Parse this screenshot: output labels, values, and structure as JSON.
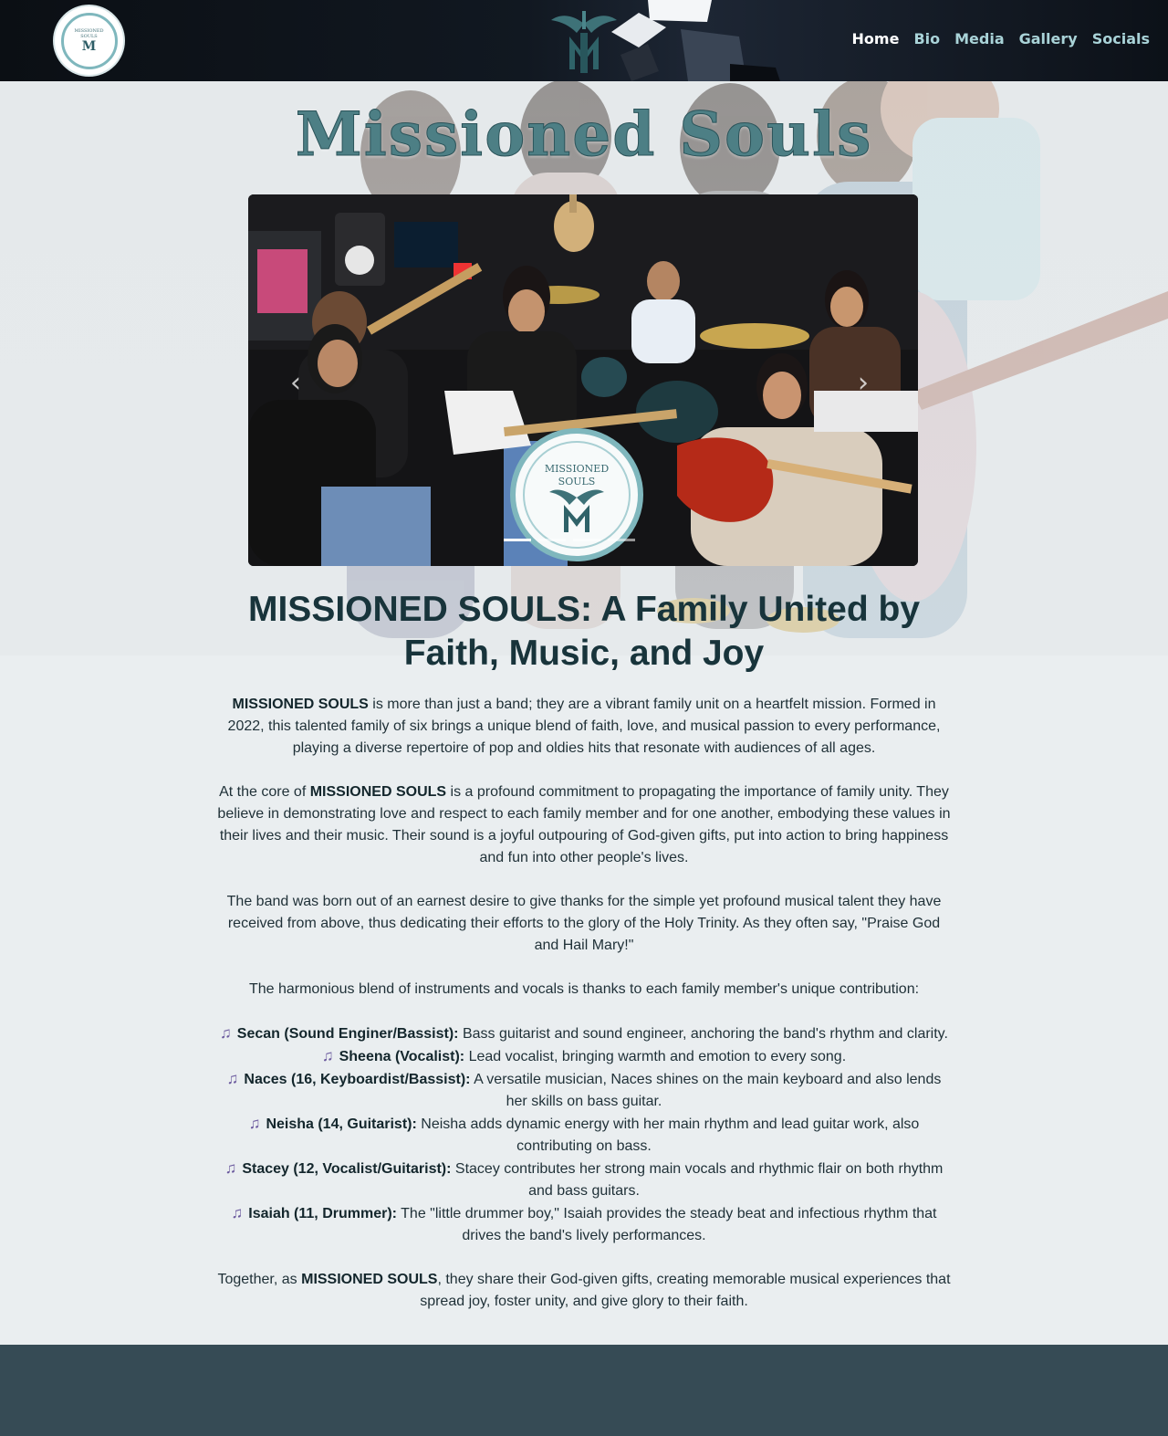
{
  "nav": {
    "items": [
      {
        "label": "Home",
        "active": true
      },
      {
        "label": "Bio",
        "active": false
      },
      {
        "label": "Media",
        "active": false
      },
      {
        "label": "Gallery",
        "active": false
      },
      {
        "label": "Socials",
        "active": false
      }
    ]
  },
  "logo": {
    "line1": "MISSIONED",
    "line2": "SOULS",
    "mono": "M"
  },
  "hero": {
    "title": "Missioned Souls",
    "slides_count": 4,
    "active_slide": 1
  },
  "headline": "MISSIONED SOULS: A Family United by Faith, Music, and Joy",
  "content": {
    "p1_bold": "MISSIONED SOULS",
    "p1_rest": " is more than just a band; they are a vibrant family unit on a heartfelt mission. Formed in 2022, this talented family of six brings a unique blend of faith, love, and musical passion to every performance, playing a diverse repertoire of pop and oldies hits that resonate with audiences of all ages.",
    "p2_pre": "At the core of ",
    "p2_bold": "MISSIONED SOULS",
    "p2_rest": " is a profound commitment to propagating the importance of family unity. They believe in demonstrating love and respect to each family member and for one another, embodying these values in their lives and their music. Their sound is a joyful outpouring of God-given gifts, put into action to bring happiness and fun into other people's lives.",
    "p3": "The band was born out of an earnest desire to give thanks for the simple yet profound musical talent they have received from above, thus dedicating their efforts to the glory of the Holy Trinity. As they often say, \"Praise God and Hail Mary!\"",
    "p4": "The harmonious blend of instruments and vocals is thanks to each family member's unique contribution:",
    "members": [
      {
        "name": "Secan (Sound Enginer/Bassist):",
        "desc": " Bass guitarist and sound engineer, anchoring the band's rhythm and clarity."
      },
      {
        "name": "Sheena (Vocalist):",
        "desc": " Lead vocalist, bringing warmth and emotion to every song."
      },
      {
        "name": "Naces (16, Keyboardist/Bassist):",
        "desc": " A versatile musician, Naces shines on the main keyboard and also lends her skills on bass guitar."
      },
      {
        "name": "Neisha (14, Guitarist):",
        "desc": " Neisha adds dynamic energy with her main rhythm and lead guitar work, also contributing on bass."
      },
      {
        "name": "Stacey (12, Vocalist/Guitarist):",
        "desc": " Stacey contributes her strong main vocals and rhythmic flair on both rhythm and bass guitars."
      },
      {
        "name": "Isaiah (11, Drummer):",
        "desc": " The \"little drummer boy,\" Isaiah provides the steady beat and infectious rhythm that drives the band's lively performances."
      }
    ],
    "p5_pre": "Together, as ",
    "p5_bold": "MISSIONED SOULS",
    "p5_rest": ", they share their God-given gifts, creating memorable musical experiences that spread joy, foster unity, and give glory to their faith."
  },
  "icons": {
    "member_bullet": "music-note-icon",
    "prev": "chevron-left-icon",
    "next": "chevron-right-icon"
  },
  "colors": {
    "header_bg": "#0b0f14",
    "nav_link": "#a9d3d8",
    "nav_active": "#ffffff",
    "accent": "#4d7f85",
    "footer_bg": "#364b55",
    "note": "#6b5a9e"
  }
}
